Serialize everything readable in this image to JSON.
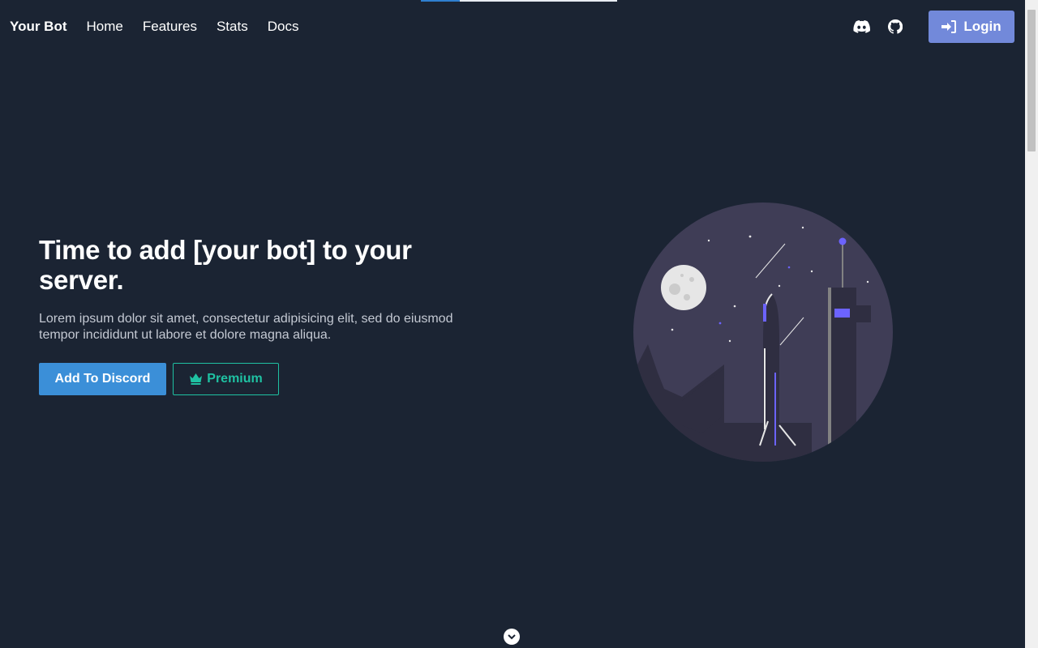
{
  "progress": {
    "fraction": 0.2
  },
  "nav": {
    "brand": "Your Bot",
    "links": [
      "Home",
      "Features",
      "Stats",
      "Docs"
    ],
    "icons": [
      "discord-icon",
      "github-icon"
    ],
    "login_label": "Login"
  },
  "hero": {
    "title": "Time to add [your bot] to your server.",
    "subtitle": "Lorem ipsum dolor sit amet, consectetur adipisicing elit, sed do eiusmod tempor incididunt ut labore et dolore magna aliqua.",
    "primary_button": "Add To Discord",
    "premium_button": "Premium"
  },
  "colors": {
    "background": "#1b2433",
    "login_button": "#7289da",
    "primary_button": "#3b8fd8",
    "premium_accent": "#1fc1a2",
    "illustration_circle": "#3f3d56",
    "illustration_accent": "#6c63ff"
  }
}
